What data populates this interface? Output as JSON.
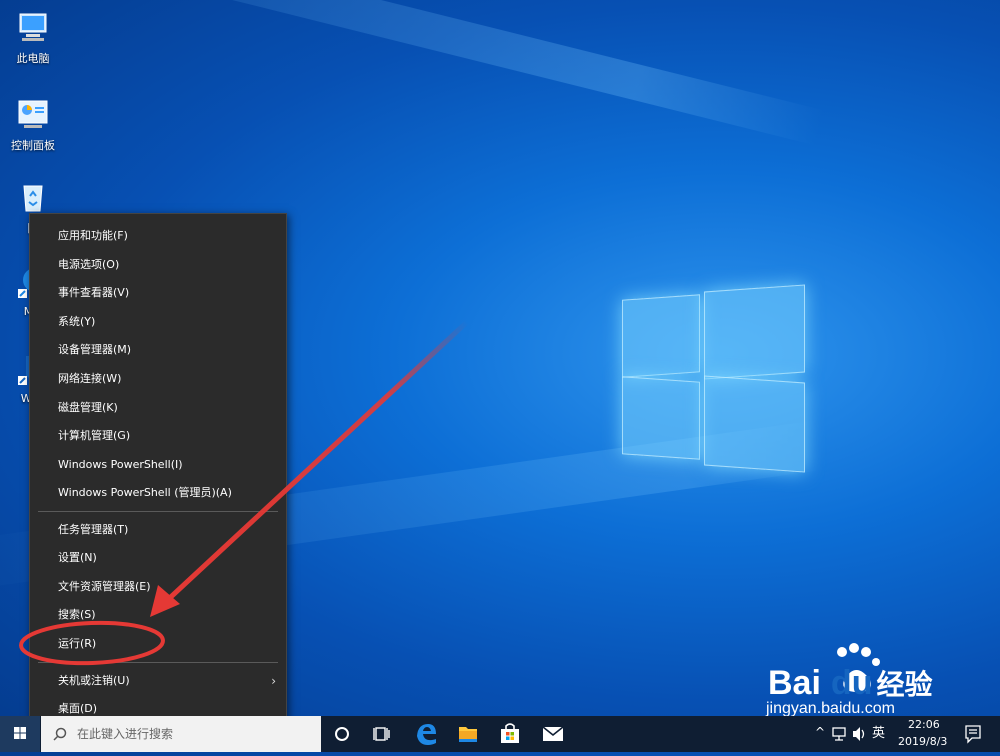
{
  "desktop": {
    "icons": [
      {
        "label": "此电脑",
        "icon": "this-pc-icon"
      },
      {
        "label": "控制面板",
        "icon": "control-panel-icon"
      },
      {
        "label": "回",
        "icon": "recycle-bin-icon"
      },
      {
        "label": "Mic",
        "label2": "E",
        "icon": "edge-shortcut-icon"
      },
      {
        "label": "WPS",
        "icon": "wps-shortcut-icon"
      }
    ]
  },
  "context_menu": {
    "items": [
      {
        "label": "应用和功能(F)"
      },
      {
        "label": "电源选项(O)"
      },
      {
        "label": "事件查看器(V)"
      },
      {
        "label": "系统(Y)"
      },
      {
        "label": "设备管理器(M)"
      },
      {
        "label": "网络连接(W)"
      },
      {
        "label": "磁盘管理(K)"
      },
      {
        "label": "计算机管理(G)"
      },
      {
        "label": "Windows PowerShell(I)"
      },
      {
        "label": "Windows PowerShell (管理员)(A)"
      },
      {
        "label": "任务管理器(T)"
      },
      {
        "label": "设置(N)"
      },
      {
        "label": "文件资源管理器(E)"
      },
      {
        "label": "搜索(S)"
      },
      {
        "label": "运行(R)",
        "highlighted": true
      },
      {
        "label": "关机或注销(U)",
        "submenu": true
      },
      {
        "label": "桌面(D)"
      }
    ]
  },
  "taskbar": {
    "search_placeholder": "在此键入进行搜索",
    "tray": {
      "ime_label": "英",
      "time": "22:06",
      "date": "2019/8/3"
    }
  },
  "watermark": {
    "brand": "Bai",
    "brand2": "du",
    "brand_cn": "经验",
    "url": "jingyan.baidu.com"
  },
  "colors": {
    "menu_bg": "#2b2b2b",
    "annotation_red": "#e53935",
    "taskbar_bg": "#0f1e33"
  }
}
